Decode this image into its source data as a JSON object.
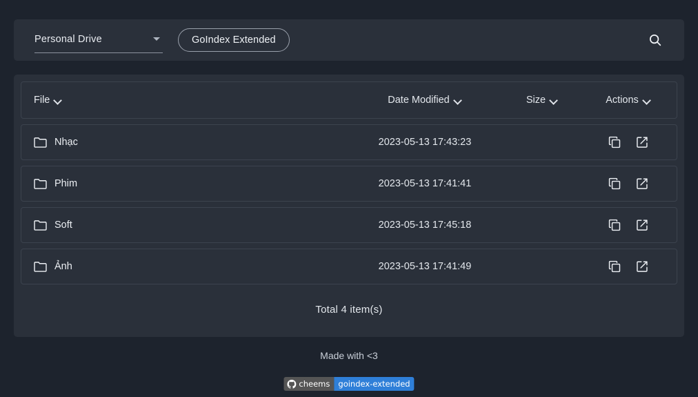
{
  "topbar": {
    "drive_select": {
      "value": "Personal Drive",
      "icon": "caret-down-icon"
    },
    "brand_button": "GoIndex Extended",
    "search_icon": "search-icon"
  },
  "table": {
    "headers": {
      "file": "File",
      "date_modified": "Date Modified",
      "size": "Size",
      "actions": "Actions"
    },
    "sort_icon": "chevron-down-icon",
    "rows": [
      {
        "name": "Nhạc",
        "icon": "folder-icon",
        "date": "2023-05-13 17:43:23",
        "size": ""
      },
      {
        "name": "Phim",
        "icon": "folder-icon",
        "date": "2023-05-13 17:41:41",
        "size": ""
      },
      {
        "name": "Soft",
        "icon": "folder-icon",
        "date": "2023-05-13 17:45:18",
        "size": ""
      },
      {
        "name": "Ảnh",
        "icon": "folder-icon",
        "date": "2023-05-13 17:41:49",
        "size": ""
      }
    ],
    "row_actions": {
      "copy_icon": "copy-icon",
      "open_icon": "open-in-new-icon"
    },
    "total": "Total 4 item(s)"
  },
  "footer": {
    "made_with": "Made with <3",
    "badge": {
      "icon": "github-icon",
      "left": "cheems",
      "right": "goindex-extended",
      "left_color": "#555555",
      "right_color": "#2f7fd8"
    }
  },
  "colors": {
    "page_background": "#1d232d",
    "card_background": "#2a303a",
    "row_border": "#3c434e",
    "text": "#e9ecf1"
  }
}
